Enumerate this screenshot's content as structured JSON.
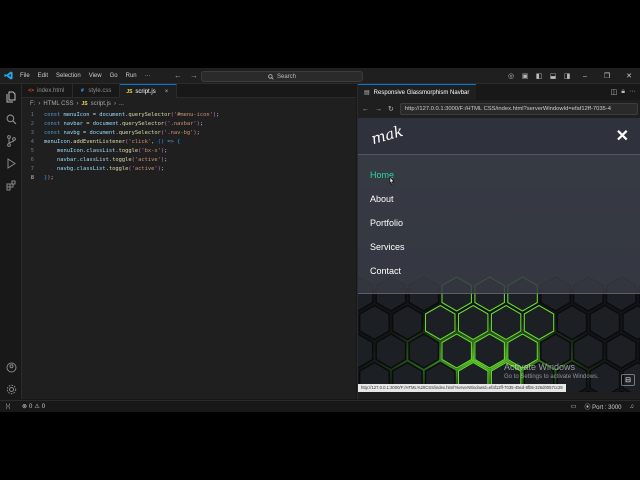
{
  "titlebar": {
    "menu": [
      "File",
      "Edit",
      "Selection",
      "View",
      "Go",
      "Run",
      "···"
    ],
    "search_label": "Search"
  },
  "editor": {
    "tabs": [
      {
        "label": "index.html",
        "icon": "html-file-icon",
        "color": "#e44d26"
      },
      {
        "label": "style.css",
        "icon": "css-file-icon",
        "color": "#42a5f5"
      },
      {
        "label": "script.js",
        "icon": "js-file-icon",
        "color": "#f0db4f",
        "active": true
      }
    ],
    "breadcrumb": [
      "F:",
      "HTML CSS",
      "script.js",
      "..."
    ],
    "line_numbers": [
      "1",
      "2",
      "3",
      "4",
      "5",
      "6",
      "7",
      "8"
    ],
    "current_line": "8"
  },
  "browser": {
    "tab_title": "Responsive Glassmorphism Navbar",
    "url": "http://127.0.0.1:3000/F:/HTML CSS/index.html?serverWindowId=efaf12ff-7035-4",
    "page": {
      "logo": "mak",
      "menu": [
        "Home",
        "About",
        "Portfolio",
        "Services",
        "Contact"
      ],
      "active_item": "Home",
      "accent_color": "#2bd99f"
    },
    "status_url": "http://127.0.0.1:3000/F:/HTML%20CSS/index.html?serverWindowId=efaf12ff-7035-45ed-8fb5-326d0057cc29",
    "watermark_title": "Activate Windows",
    "watermark_sub": "Go to Settings to activate Windows."
  },
  "statusbar": {
    "errors": "0",
    "warnings": "0",
    "port": "Port : 3000"
  }
}
